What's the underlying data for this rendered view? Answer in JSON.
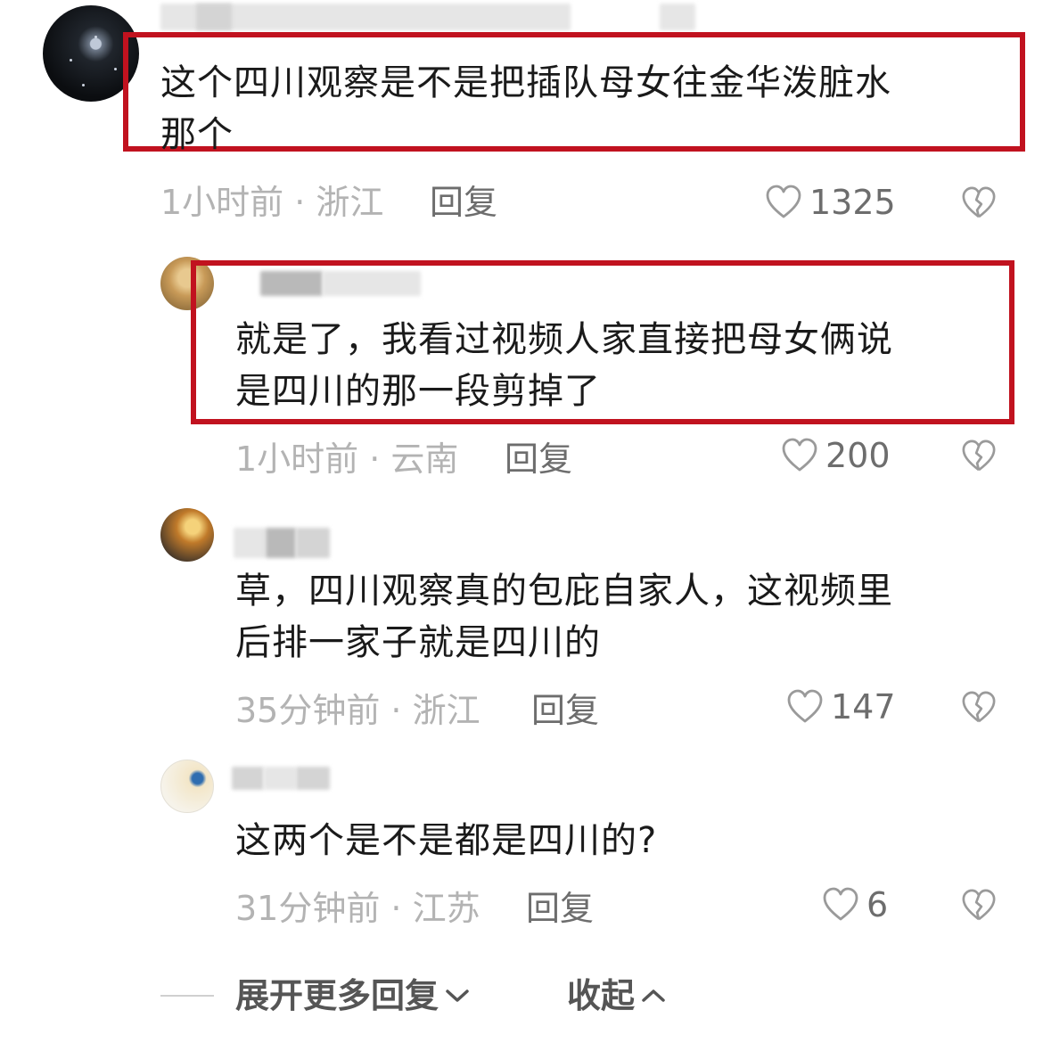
{
  "comments": [
    {
      "text_line1": "这个四川观察是不是把插队母女往金华泼脏水",
      "text_line2": "那个",
      "time": "1小时前",
      "location": "浙江",
      "meta": "1小时前 · 浙江",
      "reply_label": "回复",
      "likes": "1325",
      "highlighted": true
    },
    {
      "text_line1": "就是了，我看过视频人家直接把母女俩说",
      "text_line2": "是四川的那一段剪掉了",
      "time": "1小时前",
      "location": "云南",
      "meta": "1小时前 · 云南",
      "reply_label": "回复",
      "likes": "200",
      "highlighted": true
    },
    {
      "text_line1": "草，四川观察真的包庇自家人，这视频里",
      "text_line2": "后排一家子就是四川的",
      "time": "35分钟前",
      "location": "浙江",
      "meta": "35分钟前 · 浙江",
      "reply_label": "回复",
      "likes": "147",
      "highlighted": false
    },
    {
      "text_line1": "这两个是不是都是四川的?",
      "text_line2": "",
      "time": "31分钟前",
      "location": "江苏",
      "meta": "31分钟前 · 江苏",
      "reply_label": "回复",
      "likes": "6",
      "highlighted": false
    }
  ],
  "footer": {
    "expand_label": "展开更多回复",
    "collapse_label": "收起"
  },
  "colors": {
    "highlight_border": "#c1121f",
    "meta_text": "#b3b3b3",
    "action_text": "#6d6d6d"
  },
  "icons": {
    "like": "heart-outline-icon",
    "dislike": "broken-heart-icon",
    "expand": "chevron-down-icon",
    "collapse": "chevron-up-icon"
  }
}
